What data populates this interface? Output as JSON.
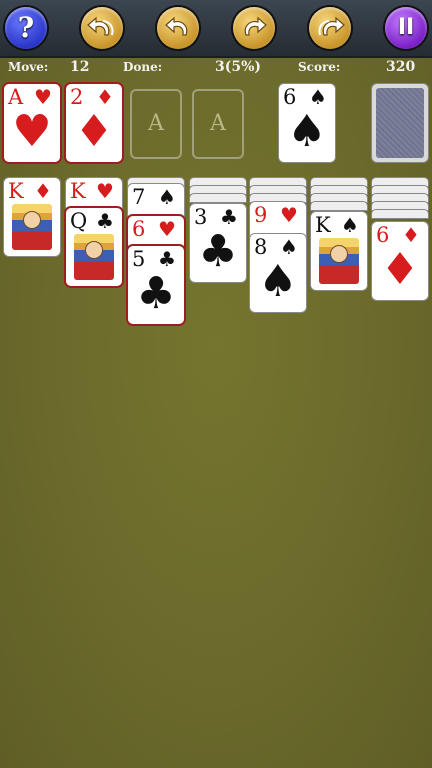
{
  "toolbar": {
    "help_label": "?",
    "pause_label": "II",
    "buttons": [
      "help-button",
      "undo-all-button",
      "undo-button",
      "redo-button",
      "redo-all-button",
      "pause-button"
    ]
  },
  "stats": {
    "move_label": "Move:",
    "move_value": "12",
    "done_label": "Done:",
    "done_value": "3(5%)",
    "score_label": "Score:",
    "score_value": "320"
  },
  "foundations": [
    {
      "rank": "A",
      "suit": "♥",
      "color": "red"
    },
    {
      "rank": "2",
      "suit": "♦",
      "color": "red"
    },
    {
      "placeholder": "A"
    },
    {
      "placeholder": "A"
    }
  ],
  "waste": {
    "rank": "6",
    "suit": "♠",
    "color": "black"
  },
  "tableau": [
    {
      "cards": [
        {
          "rank": "K",
          "suit": "♦",
          "color": "red",
          "court": true
        }
      ]
    },
    {
      "cards": [
        {
          "rank": "K",
          "suit": "♥",
          "color": "red",
          "court": true
        },
        {
          "rank": "Q",
          "suit": "♣",
          "color": "black",
          "court": true
        }
      ]
    },
    {
      "cards": [
        {
          "rank": "7",
          "suit": "♠",
          "color": "black"
        },
        {
          "rank": "6",
          "suit": "♥",
          "color": "red"
        },
        {
          "rank": "5",
          "suit": "♣",
          "color": "black"
        }
      ]
    },
    {
      "cards": [
        {
          "rank": "3",
          "suit": "♣",
          "color": "black"
        }
      ]
    },
    {
      "cards": [
        {
          "rank": "9",
          "suit": "♥",
          "color": "red"
        },
        {
          "rank": "8",
          "suit": "♠",
          "color": "black"
        }
      ]
    },
    {
      "cards": [
        {
          "rank": "K",
          "suit": "♠",
          "color": "black",
          "court": true
        }
      ]
    },
    {
      "cards": [
        {
          "rank": "6",
          "suit": "♦",
          "color": "red"
        }
      ]
    }
  ],
  "colors": {
    "felt": "#6b6a2b",
    "red_suit": "#d61c1c",
    "black_suit": "#111111",
    "selection": "#9c1f1f"
  }
}
